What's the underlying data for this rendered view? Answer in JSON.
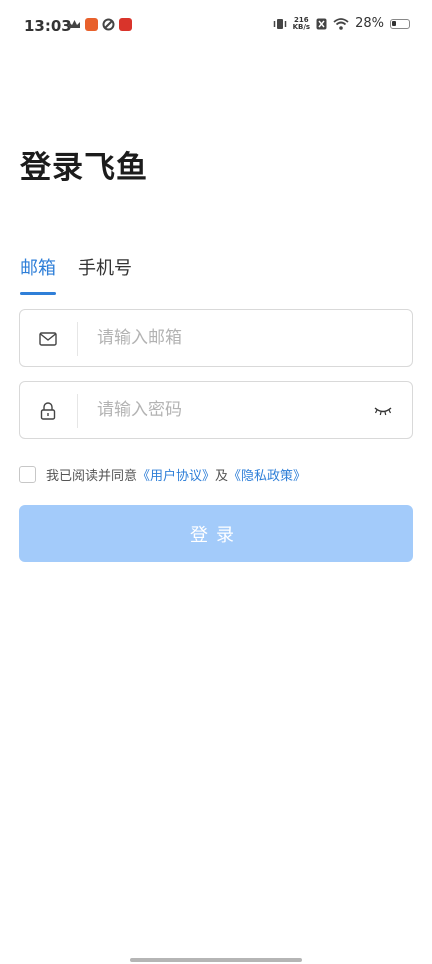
{
  "status_bar": {
    "time": "13:03",
    "net_speed_value": "216",
    "net_speed_unit": "KB/s",
    "battery": "28%",
    "battery_level": 0.28
  },
  "title": "登录飞鱼",
  "tabs": [
    {
      "label": "邮箱",
      "active": true
    },
    {
      "label": "手机号",
      "active": false
    }
  ],
  "email_field": {
    "placeholder": "请输入邮箱",
    "value": ""
  },
  "password_field": {
    "placeholder": "请输入密码",
    "value": ""
  },
  "agreement": {
    "prefix": "我已阅读并同意",
    "user_agreement": "《用户协议》",
    "and": "及",
    "privacy_policy": "《隐私政策》",
    "checked": false
  },
  "login_button": {
    "label": "登录"
  },
  "colors": {
    "accent": "#2f7fd8",
    "button_disabled": "#a3cbfa",
    "border": "#d9d9d9"
  },
  "icons": {
    "email": "mail-icon",
    "password": "lock-icon",
    "visibility": "eye-closed-icon"
  }
}
